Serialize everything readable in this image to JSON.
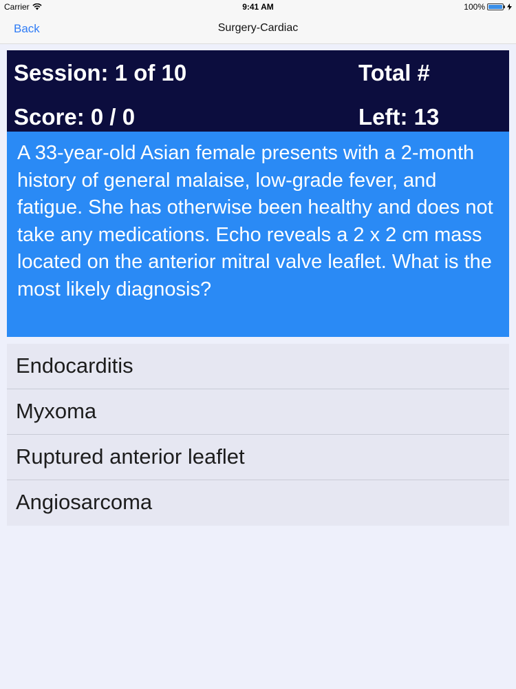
{
  "status_bar": {
    "carrier": "Carrier",
    "time": "9:41 AM",
    "battery": "100%",
    "battery_level": 1.0,
    "wifi_icon": "wifi-icon",
    "charging_icon": "lightning-icon"
  },
  "nav": {
    "back_label": "Back",
    "title": "Surgery-Cardiac"
  },
  "header": {
    "session": "Session: 1 of 10",
    "total": "Total #",
    "score": "Score: 0 / 0",
    "left": "Left: 13"
  },
  "question": {
    "text": "A 33-year-old Asian female presents with a 2-month history of general malaise, low-grade fever, and fatigue. She has otherwise been healthy and does not take any medications. Echo reveals a 2 x 2 cm mass located on the anterior mitral valve leaflet. What is the most likely diagnosis?"
  },
  "answers": [
    {
      "label": "Endocarditis"
    },
    {
      "label": "Myxoma"
    },
    {
      "label": "Ruptured anterior leaflet"
    },
    {
      "label": "Angiosarcoma"
    }
  ],
  "colors": {
    "header_bg": "#0c0d3e",
    "question_bg": "#2a8af5",
    "accent": "#2f7cf6",
    "answers_bg": "#e6e7f2",
    "page_bg": "#eef0fb"
  }
}
